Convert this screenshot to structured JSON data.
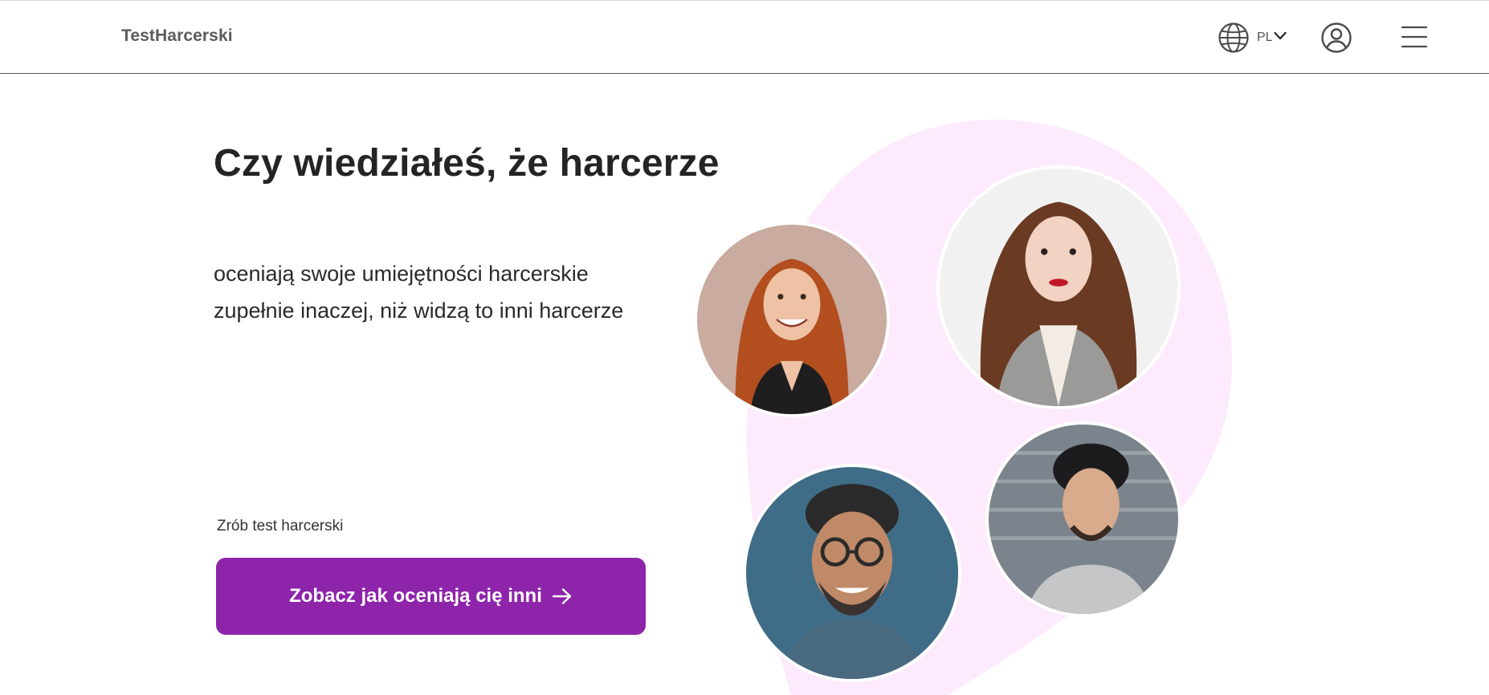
{
  "header": {
    "logo": "TestHarcerski",
    "language": {
      "code": "PL",
      "globe_icon": "globe-icon",
      "chevron_icon": "chevron-down-icon"
    },
    "account_icon": "user-circle-icon",
    "menu_icon": "hamburger-menu-icon"
  },
  "hero": {
    "headline": "Czy wiedziałeś, że harcerze",
    "subtext_line1": "oceniają swoje umiejętności harcerskie",
    "subtext_line2": "zupełnie inaczej, niż widzą to inni harcerze",
    "cta_label": "Zrób test harcerski",
    "cta_button": "Zobacz jak oceniają cię inni",
    "cta_arrow_icon": "arrow-right-icon"
  },
  "colors": {
    "accent": "#8e24aa",
    "blob": "#fdeafc",
    "header_border": "#5a5a5a",
    "text_dark": "#242424"
  }
}
